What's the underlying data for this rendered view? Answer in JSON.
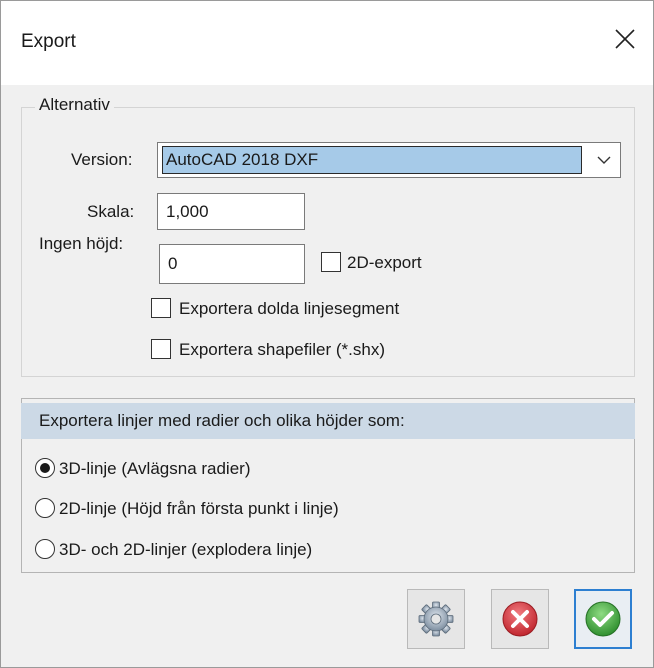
{
  "window": {
    "title": "Export"
  },
  "options": {
    "legend": "Alternativ",
    "version_label": "Version:",
    "version_value": "AutoCAD 2018 DXF",
    "scale_label": "Skala:",
    "scale_value": "1,000",
    "no_height_label": "Ingen höjd:",
    "no_height_value": "0",
    "export_2d_label": "2D-export",
    "hidden_segments_label": "Exportera dolda linjesegment",
    "shapefiles_label": "Exportera shapefiler (*.shx)"
  },
  "lines": {
    "header": "Exportera linjer med radier och olika höjder som:",
    "choices": [
      {
        "label": "3D-linje (Avlägsna radier)",
        "selected": true
      },
      {
        "label": "2D-linje (Höjd från första punkt i linje)",
        "selected": false
      },
      {
        "label": "3D- och 2D-linjer (explodera linje)",
        "selected": false
      }
    ]
  },
  "buttons": {
    "settings_icon": "gear-icon",
    "cancel_icon": "red-x-circle-icon",
    "ok_icon": "green-check-circle-icon"
  },
  "colors": {
    "selection_bg": "#a6cae8",
    "header_bg": "#ccd9e6",
    "focus_border": "#2d7fd1",
    "cancel_red": "#d9363e",
    "ok_green": "#3aa53a"
  }
}
